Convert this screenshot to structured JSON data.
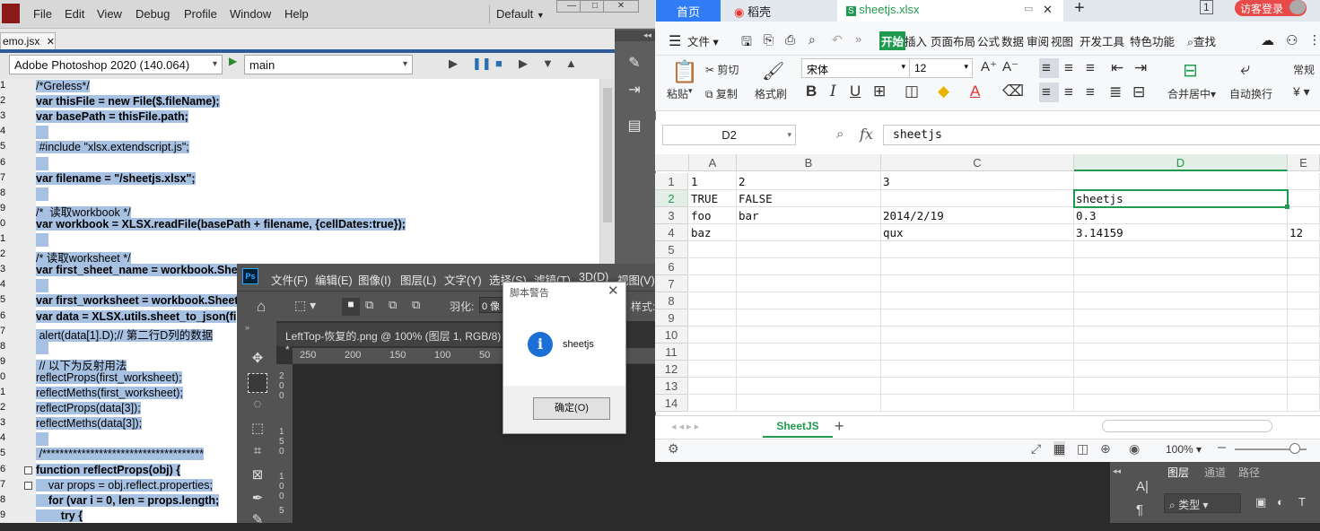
{
  "estk": {
    "menus": [
      "File",
      "Edit",
      "View",
      "Debug",
      "Profile",
      "Window",
      "Help"
    ],
    "workspace": "Default",
    "doc_tab": "emo.jsx",
    "target_app": "Adobe Photoshop 2020 (140.064)",
    "engine": "main",
    "line_numbers": [
      "1",
      "2",
      "3",
      "4",
      "5",
      "6",
      "7",
      "8",
      "9",
      "0",
      "1",
      "2",
      "3",
      "4",
      "5",
      "6",
      "7",
      "8",
      "9",
      "0",
      "1",
      "2",
      "3",
      "4",
      "5",
      "6",
      "7",
      "8",
      "9"
    ],
    "code": [
      {
        "text": "/*Greless*/"
      },
      {
        "text": "var thisFile = new File($.fileName);"
      },
      {
        "text": "var basePath = thisFile.path;"
      },
      {
        "text": ""
      },
      {
        "text": " #include \"xlsx.extendscript.js\";"
      },
      {
        "text": ""
      },
      {
        "text": "var filename = \"/sheetjs.xlsx\";"
      },
      {
        "text": ""
      },
      {
        "text": "/*  读取workbook */"
      },
      {
        "text": "var workbook = XLSX.readFile(basePath + filename, {cellDates:true});"
      },
      {
        "text": ""
      },
      {
        "text": "/* 读取worksheet */"
      },
      {
        "text": "var first_sheet_name = workbook.She"
      },
      {
        "text": ""
      },
      {
        "text": "var first_worksheet = workbook.Sheet"
      },
      {
        "text": "var data = XLSX.utils.sheet_to_json(fi"
      },
      {
        "text": " alert(data[1].D);// 第二行D列的数据"
      },
      {
        "text": ""
      },
      {
        "text": " // 以下为反射用法"
      },
      {
        "text": "reflectProps(first_worksheet);"
      },
      {
        "text": "reflectMeths(first_worksheet);"
      },
      {
        "text": "reflectProps(data[3]);"
      },
      {
        "text": "reflectMeths(data[3]);"
      },
      {
        "text": ""
      },
      {
        "text": " /*************************************"
      },
      {
        "text": "function reflectProps(obj) {"
      },
      {
        "text": "    var props = obj.reflect.properties;"
      },
      {
        "text": "    for (var i = 0, len = props.length;"
      },
      {
        "text": "        try {"
      }
    ]
  },
  "photoshop": {
    "logo": "Ps",
    "menus": [
      "文件(F)",
      "编辑(E)",
      "图像(I)",
      "图层(L)",
      "文字(Y)",
      "选择(S)",
      "滤镜(T)",
      "3D(D)",
      "视图(V)"
    ],
    "feather_label": "羽化:",
    "feather_value": "0 像",
    "style_label": "样式:",
    "doc_tab": "LeftTop-恢复的.png @ 100% (图层 1, RGB/8) *",
    "ruler_h": [
      "250",
      "200",
      "150",
      "100",
      "50"
    ],
    "ruler_v": [
      "2\n0\n0",
      "1\n5\n0",
      "1\n0\n0",
      "5"
    ]
  },
  "dialog": {
    "title": "脚本警告",
    "message": "sheetjs",
    "ok_label": "确定(O)"
  },
  "wps": {
    "tab_home": "首页",
    "tab_daoke": "稻壳",
    "tab_file": "sheetjs.xlsx",
    "login": "访客登录",
    "file_menu": "文件",
    "ribbon_tabs": [
      "开始",
      "插入",
      "页面布局",
      "公式",
      "数据",
      "审阅",
      "视图",
      "开发工具",
      "特色功能"
    ],
    "search": "查找",
    "paste": "粘贴",
    "cut": "剪切",
    "copy": "复制",
    "format_painter": "格式刷",
    "font_name": "宋体",
    "font_size": "12",
    "merge": "合并居中",
    "wrap": "自动换行",
    "number_format": "常规",
    "currency": "¥",
    "name_box": "D2",
    "formula": "sheetjs",
    "columns": [
      "A",
      "B",
      "C",
      "D",
      "E"
    ],
    "rows": [
      "1",
      "2",
      "3",
      "4",
      "5",
      "6",
      "7",
      "8",
      "9",
      "10",
      "11",
      "12",
      "13",
      "14"
    ],
    "cells": [
      [
        "1",
        "2",
        "3",
        "",
        ""
      ],
      [
        "TRUE",
        "FALSE",
        "",
        "sheetjs",
        ""
      ],
      [
        "foo",
        "bar",
        "2014/2/19",
        "0.3",
        ""
      ],
      [
        "baz",
        "",
        "qux",
        "3.14159",
        "12"
      ]
    ],
    "sheet_name": "SheetJS",
    "zoom": "100%",
    "accent": "#1e9b4e"
  },
  "layers_panel": {
    "tabs": [
      "图层",
      "通道",
      "路径"
    ],
    "filter": "类型"
  }
}
